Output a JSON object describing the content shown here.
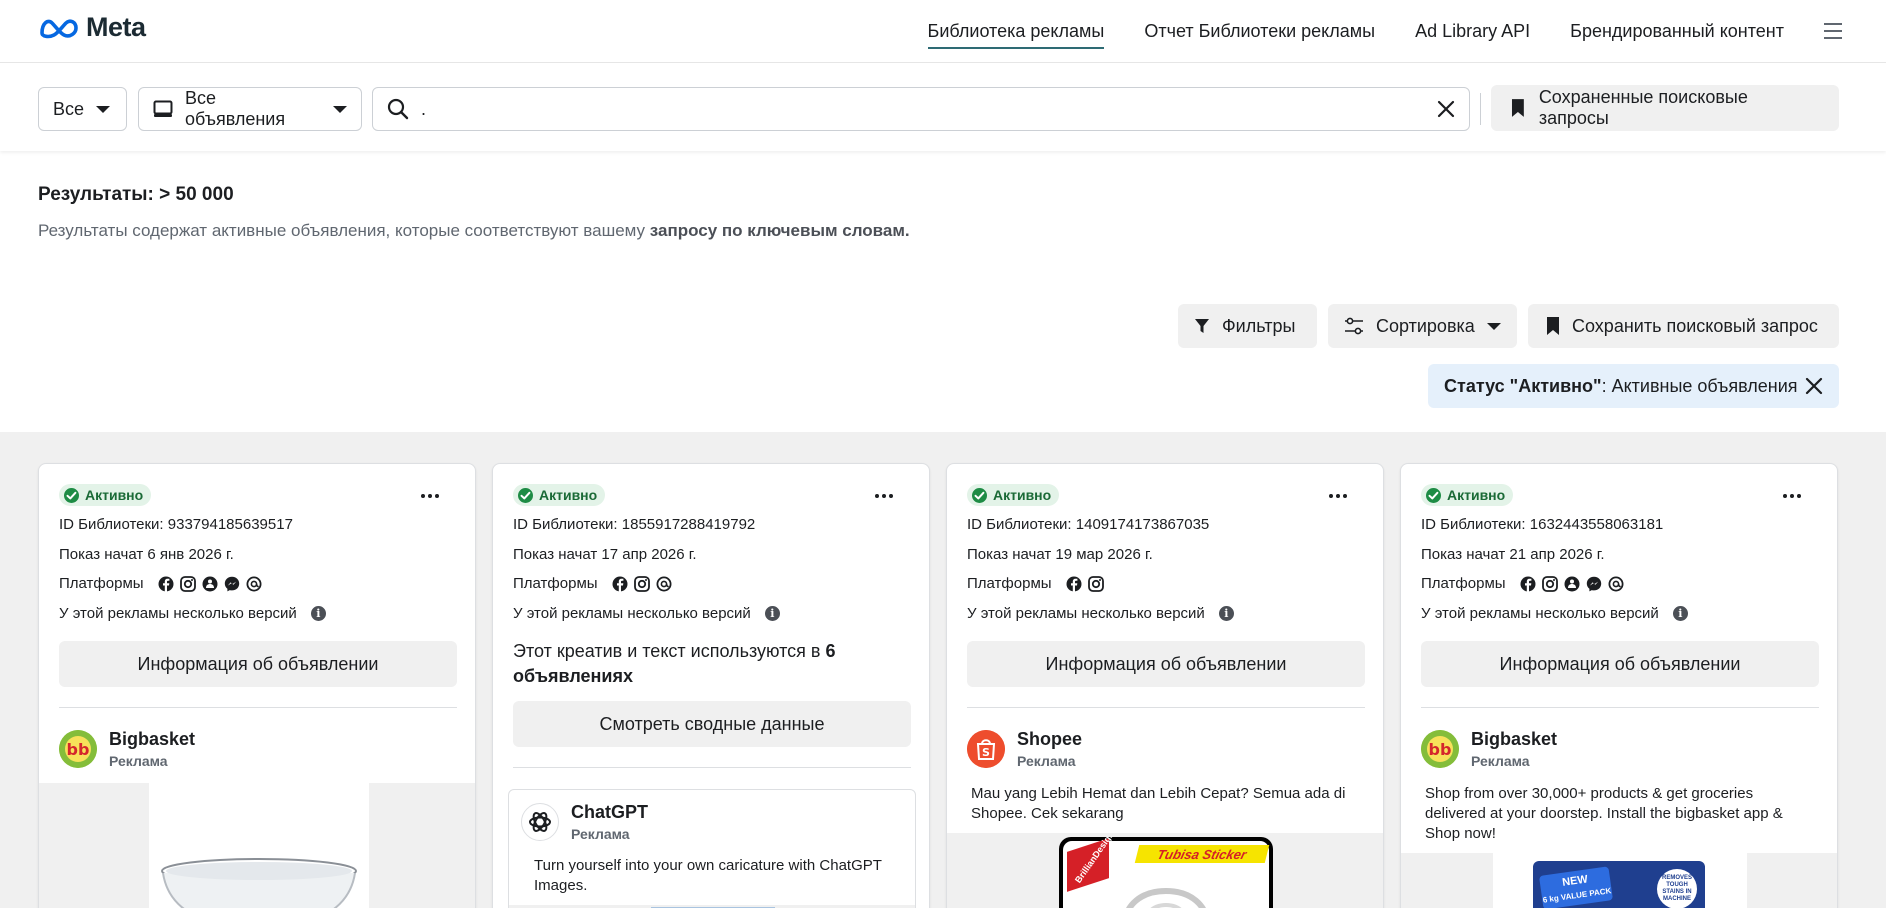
{
  "header": {
    "logo_text": "Meta",
    "nav": [
      {
        "label": "Библиотека рекламы",
        "active": true
      },
      {
        "label": "Отчет Библиотеки рекламы",
        "active": false
      },
      {
        "label": "Ad Library API",
        "active": false
      },
      {
        "label": "Брендированный контент",
        "active": false
      }
    ]
  },
  "search": {
    "country_dropdown": "Все",
    "category_dropdown": "Все объявления",
    "query_value": ".",
    "saved_searches_label": "Сохраненные поисковые запросы"
  },
  "results": {
    "title": "Результаты: > 50 000",
    "desc_prefix": "Результаты содержат активные объявления, которые соответствуют вашему ",
    "desc_bold": "запросу по ключевым словам."
  },
  "actions": {
    "filters": "Фильтры",
    "sort": "Сортировка",
    "save_search": "Сохранить поисковый запрос"
  },
  "status_chip": {
    "bold": "Статус \"Активно\"",
    "rest": ": Активные объявления"
  },
  "cards": [
    {
      "status": "Активно",
      "library_id": "ID Библиотеки: 933794185639517",
      "started": "Показ начат 6 янв 2026 г.",
      "platforms_label": "Платформы",
      "platforms": [
        "facebook-icon",
        "instagram-icon",
        "audience-network-icon",
        "messenger-icon",
        "threads-icon"
      ],
      "versions": "У этой рекламы несколько версий",
      "button": "Информация об объявлении",
      "advertiser": "Bigbasket",
      "sponsored": "Реклама",
      "ad_text": ""
    },
    {
      "status": "Активно",
      "library_id": "ID Библиотеки: 1855917288419792",
      "started": "Показ начат 17 апр 2026 г.",
      "platforms_label": "Платформы",
      "platforms": [
        "facebook-icon",
        "instagram-icon",
        "threads-icon"
      ],
      "versions": "У этой рекламы несколько версий",
      "creative_prefix": "Этот креатив и текст используются в ",
      "creative_bold": "6 объявлениях",
      "button": "Смотреть сводные данные",
      "advertiser": "ChatGPT",
      "sponsored": "Реклама",
      "ad_text": "Turn yourself into your own caricature with ChatGPT Images."
    },
    {
      "status": "Активно",
      "library_id": "ID Библиотеки: 1409174173867035",
      "started": "Показ начат 19 мар 2026 г.",
      "platforms_label": "Платформы",
      "platforms": [
        "facebook-icon",
        "instagram-icon"
      ],
      "versions": "У этой рекламы несколько версий",
      "button": "Информация об объявлении",
      "advertiser": "Shopee",
      "sponsored": "Реклама",
      "ad_text": "Mau yang Lebih Hemat dan Lebih Cepat? Semua ada di Shopee. Cek sekarang"
    },
    {
      "status": "Активно",
      "library_id": "ID Библиотеки: 1632443558063181",
      "started": "Показ начат 21 апр 2026 г.",
      "platforms_label": "Платформы",
      "platforms": [
        "facebook-icon",
        "instagram-icon",
        "audience-network-icon",
        "messenger-icon",
        "threads-icon"
      ],
      "versions": "У этой рекламы несколько версий",
      "button": "Информация об объявлении",
      "advertiser": "Bigbasket",
      "sponsored": "Реклама",
      "ad_text": "Shop from over 30,000+ products & get groceries delivered at your doorstep. Install the bigbasket app & Shop now!"
    }
  ],
  "creative_labels": {
    "sticker_brand": "Tubisa Sticker",
    "sticker_site": "BrillianDesign.co",
    "pack_badge_top": "NEW",
    "pack_badge_bottom": "6 kg VALUE PACK",
    "pack_seal": "REMOVES TOUGH STAINS IN MACHINE"
  },
  "colors": {
    "accent_underline": "#2e6b74",
    "active_badge_bg": "#e3f3e8",
    "active_badge_text": "#1a6a36",
    "status_chip_bg": "#e5f0fb",
    "button_bg": "#f0f0f0"
  }
}
